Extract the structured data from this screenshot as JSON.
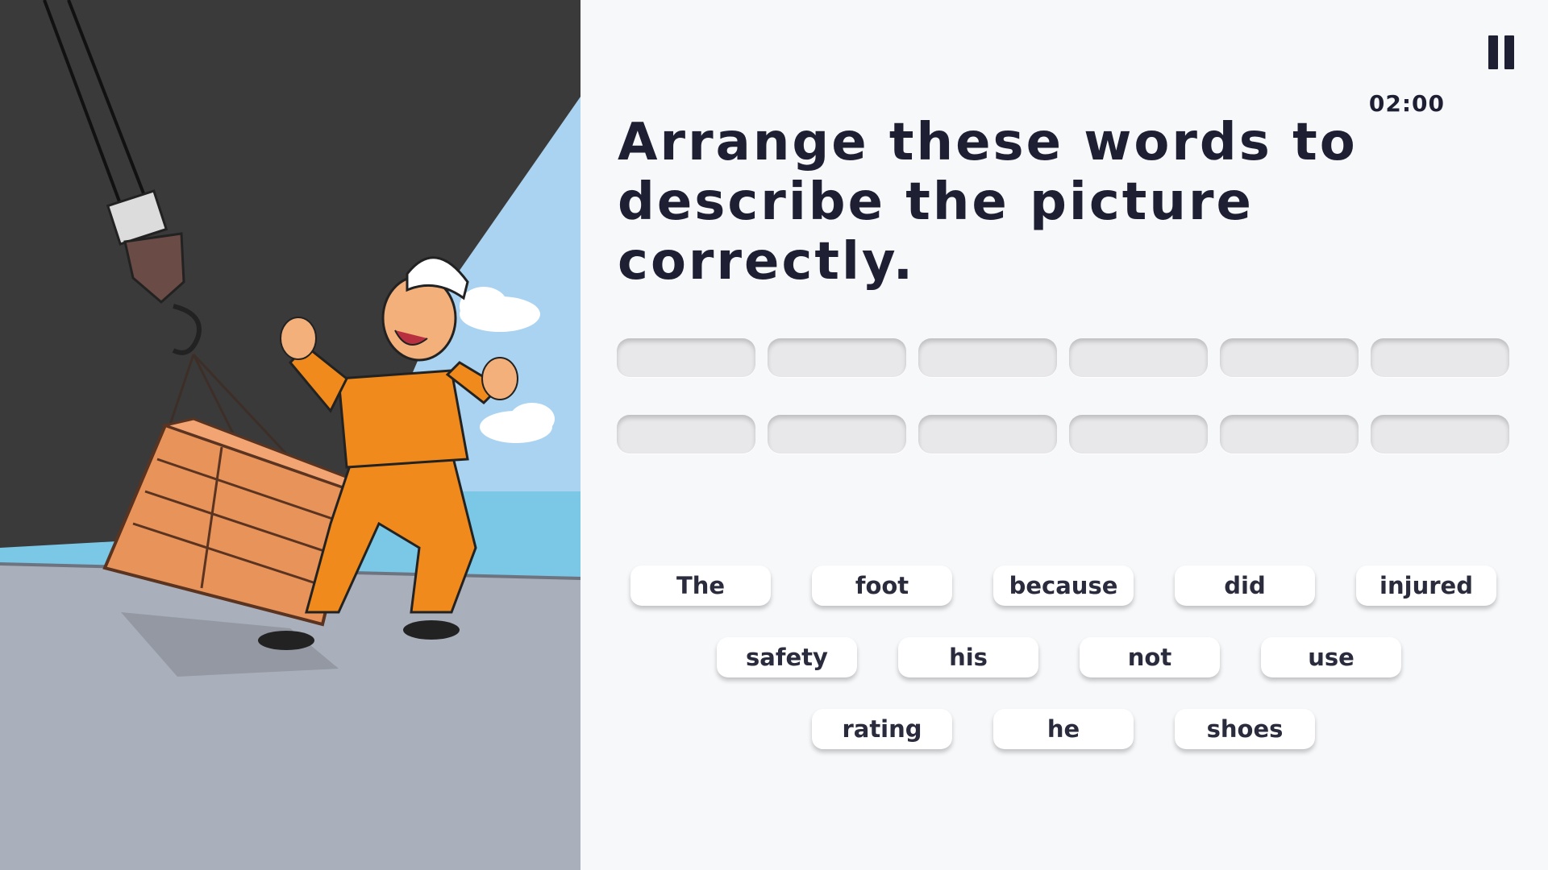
{
  "illustration": {
    "alt": "Rating injured by falling crate",
    "colors": {
      "hull": "#3a3a3a",
      "sky": "#a9d3f0",
      "sea": "#7ac7e6",
      "deck": "#a9b0bb",
      "coverall": "#f08a1c",
      "crate": "#e8935a",
      "helmet": "#ffffff"
    }
  },
  "header": {
    "timer": "02:00",
    "pause_icon": "pause-icon"
  },
  "question": {
    "prompt": "Arrange these words to describe the picture correctly."
  },
  "answer_slots": {
    "count": 12
  },
  "word_bank": {
    "rows": [
      [
        "The",
        "foot",
        "because",
        "did",
        "injured"
      ],
      [
        "safety",
        "his",
        "not",
        "use"
      ],
      [
        "rating",
        "he",
        "shoes"
      ]
    ]
  }
}
